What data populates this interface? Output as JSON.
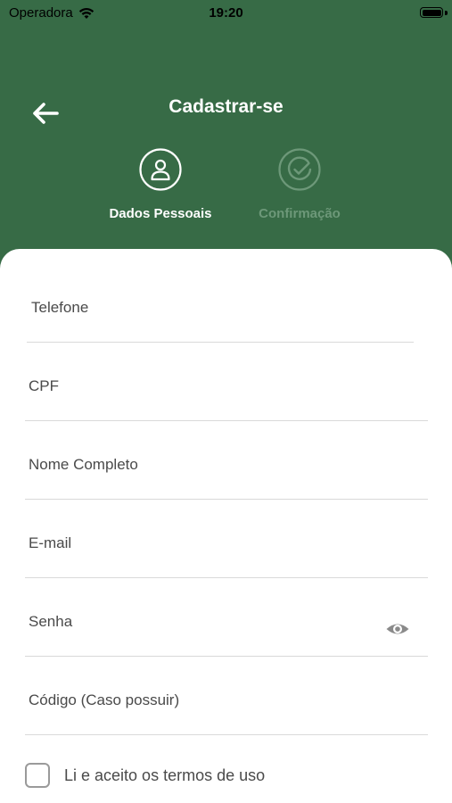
{
  "status_bar": {
    "carrier": "Operadora",
    "time": "19:20"
  },
  "header": {
    "title": "Cadastrar-se",
    "steps": [
      {
        "label": "Dados Pessoais",
        "active": true
      },
      {
        "label": "Confirmação",
        "active": false
      }
    ]
  },
  "form": {
    "fields": [
      {
        "label": "Telefone",
        "value": ""
      },
      {
        "label": "CPF",
        "value": ""
      },
      {
        "label": "Nome Completo",
        "value": ""
      },
      {
        "label": "E-mail",
        "value": ""
      },
      {
        "label": "Senha",
        "value": ""
      },
      {
        "label": "Código (Caso possuir)",
        "value": ""
      }
    ],
    "terms_label": "Li e aceito os termos de uso",
    "terms_checked": false
  },
  "colors": {
    "brand": "#376b46",
    "inactive_step": "#6d9879",
    "card": "#ffffff"
  },
  "icons": {
    "back": "arrow-left-icon",
    "step1": "user-icon",
    "step2": "check-circle-icon",
    "password": "eye-icon",
    "wifi": "wifi-icon",
    "battery": "battery-icon"
  }
}
